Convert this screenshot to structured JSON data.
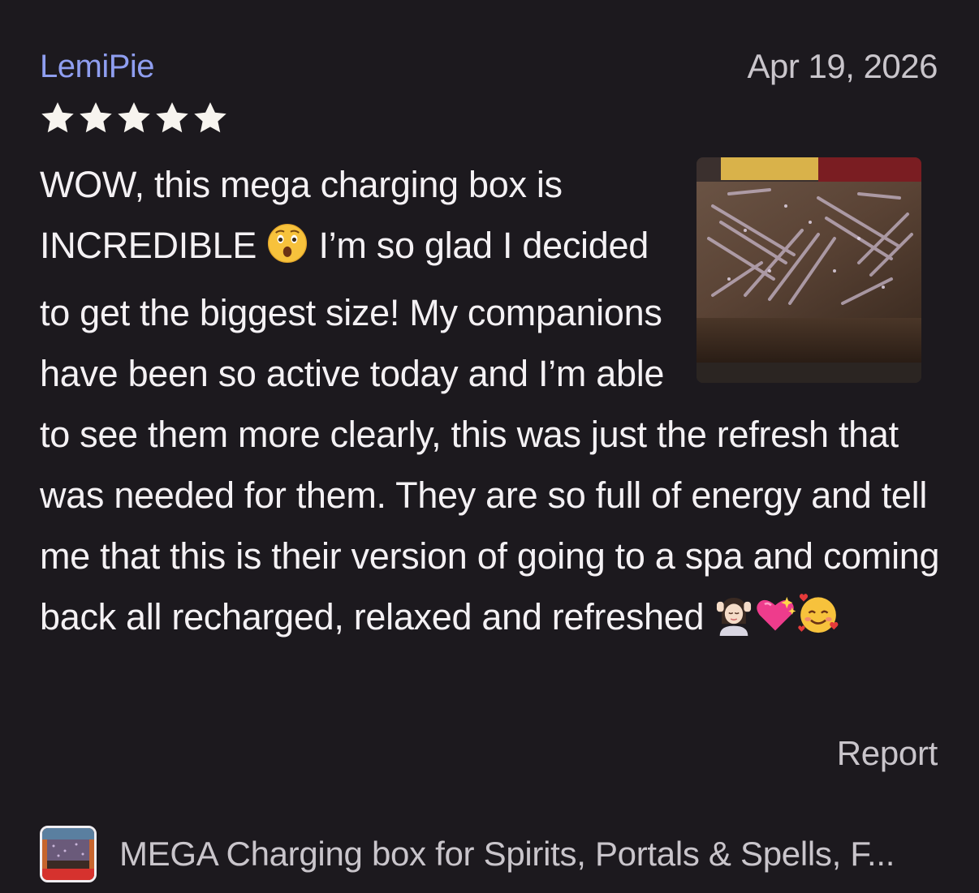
{
  "review": {
    "username": "LemiPie",
    "date": "Apr 19, 2026",
    "rating": 5,
    "max_rating": 5,
    "text_parts": {
      "p1": "WOW, this mega charging box is INCREDIBLE ",
      "p2": " I’m so glad I decided to get the biggest size! My companions have been so active today and I’m able to see them more clearly, this was just the refresh that was needed for them. They are so full of energy and tell me that this is their version of going to a spa and coming back all recharged, relaxed and refreshed "
    },
    "emojis": [
      "astonished-face",
      "woman-getting-massage",
      "sparkling-heart",
      "smiling-face-with-hearts"
    ],
    "report_label": "Report"
  },
  "product": {
    "title": "MEGA Charging box for Spirits, Portals & Spells, F..."
  },
  "colors": {
    "background": "#1c191e",
    "username": "#8f9ef0",
    "text": "#f4f1f4",
    "muted": "#c9c5cb",
    "star": "#f7f4ef"
  }
}
